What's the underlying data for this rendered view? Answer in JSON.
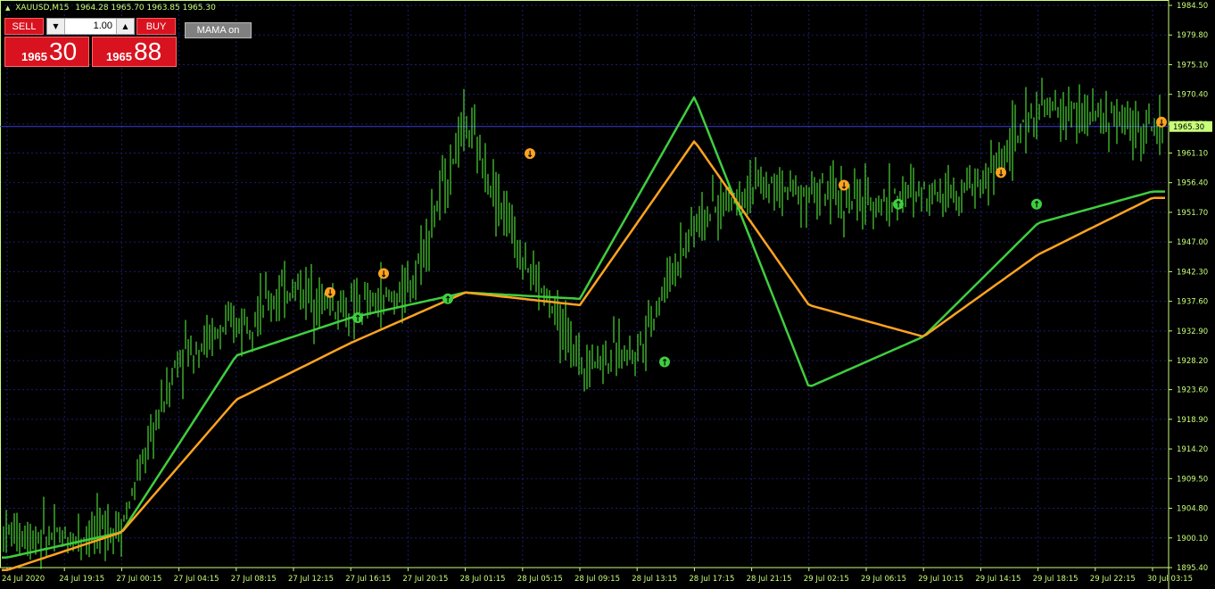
{
  "header": {
    "symbol": "XAUUSD,M15",
    "ohlc": "1964.28 1965.70 1963.85 1965.30"
  },
  "trade_panel": {
    "sell_label": "SELL",
    "buy_label": "BUY",
    "lot_value": "1.00",
    "bid_big": "1965",
    "bid_small": "30",
    "ask_big": "1965",
    "ask_small": "88"
  },
  "indicator_button": {
    "label": "MAMA  on"
  },
  "colors": {
    "background": "#000000",
    "candles": "#5aff3c",
    "mama_line": "#3fce3f",
    "fama_line": "#ffa320",
    "grid": "#1c1c6e",
    "axis": "#c8ff7a",
    "current_price_tag": "#c8ff7a"
  },
  "chart_data": {
    "type": "line",
    "y_ticks": [
      "1984.50",
      "1979.80",
      "1975.10",
      "1970.40",
      "1965.70",
      "1961.10",
      "1956.40",
      "1951.70",
      "1947.00",
      "1942.30",
      "1937.60",
      "1932.90",
      "1928.20",
      "1923.60",
      "1918.90",
      "1914.20",
      "1909.50",
      "1904.80",
      "1900.10",
      "1895.40"
    ],
    "x_ticks": [
      "24 Jul 2020",
      "24 Jul 19:15",
      "27 Jul 00:15",
      "27 Jul 04:15",
      "27 Jul 08:15",
      "27 Jul 12:15",
      "27 Jul 16:15",
      "27 Jul 20:15",
      "28 Jul 01:15",
      "28 Jul 05:15",
      "28 Jul 09:15",
      "28 Jul 13:15",
      "28 Jul 17:15",
      "28 Jul 21:15",
      "29 Jul 02:15",
      "29 Jul 06:15",
      "29 Jul 10:15",
      "29 Jul 14:15",
      "29 Jul 18:15",
      "29 Jul 22:15",
      "30 Jul 03:15"
    ],
    "current_price": "1965.30",
    "ylim": [
      1895.4,
      1984.5
    ],
    "grid": true,
    "series": [
      {
        "name": "MAMA",
        "x": [
          0,
          2,
          4,
          6,
          8,
          10,
          12,
          14,
          16,
          18,
          20
        ],
        "values": [
          1897,
          1901,
          1929,
          1935,
          1939,
          1938,
          1970,
          1924,
          1932,
          1950,
          1955
        ]
      },
      {
        "name": "FAMA",
        "x": [
          0,
          2,
          4,
          6,
          8,
          10,
          12,
          14,
          16,
          18,
          20
        ],
        "values": [
          1895,
          1901,
          1922,
          1931,
          1939,
          1937,
          1963,
          1937,
          1932,
          1945,
          1954
        ]
      }
    ],
    "price_path": {
      "x": [
        0,
        1,
        2,
        3,
        4,
        5,
        6,
        7,
        8,
        9,
        10,
        11,
        12,
        13,
        14,
        15,
        16,
        17,
        18,
        19,
        20
      ],
      "values": [
        1901,
        1900,
        1902,
        1929,
        1934,
        1940,
        1936,
        1939,
        1966,
        1945,
        1928,
        1930,
        1950,
        1956,
        1955,
        1953,
        1955,
        1956,
        1968,
        1967,
        1965
      ]
    }
  }
}
